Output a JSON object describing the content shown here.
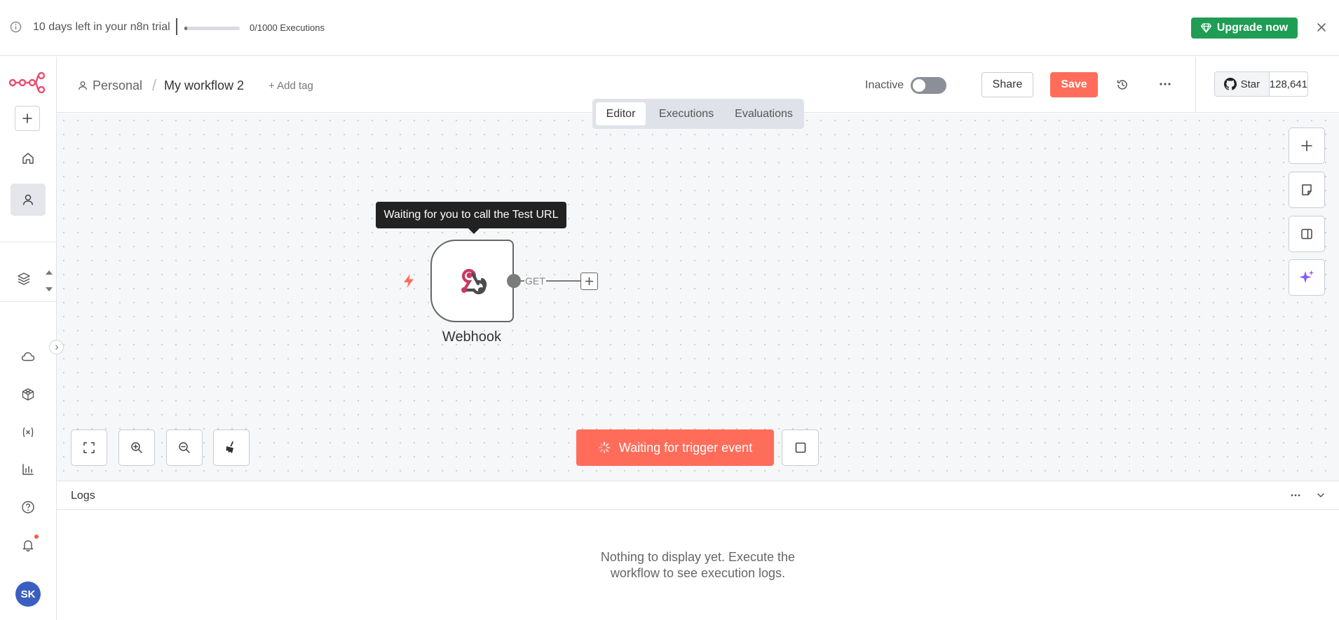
{
  "banner": {
    "trial_text": "10 days left in your n8n trial",
    "executions": "0/1000 Executions",
    "execution_progress": 0.02,
    "upgrade_label": "Upgrade now"
  },
  "breadcrumb": {
    "project": "Personal",
    "separator": "/",
    "workflow_name": "My workflow 2",
    "add_tag": "+ Add tag"
  },
  "header": {
    "status_label": "Inactive",
    "active": false,
    "share_label": "Share",
    "save_label": "Save",
    "github_star_label": "Star",
    "github_star_count": "128,641"
  },
  "tabs": [
    {
      "label": "Editor",
      "active": true
    },
    {
      "label": "Executions",
      "active": false
    },
    {
      "label": "Evaluations",
      "active": false
    }
  ],
  "canvas": {
    "tooltip": "Waiting for you to call the Test URL",
    "node_label": "Webhook",
    "output_label": "GET",
    "trigger_button": "Waiting for trigger event"
  },
  "sidebar": {
    "avatar_initials": "SK",
    "icons": [
      "home-icon",
      "user-icon",
      "layers-icon",
      "cloud-icon",
      "templates-icon",
      "variables-icon",
      "insights-icon",
      "help-icon",
      "bell-icon"
    ]
  },
  "logs": {
    "title": "Logs",
    "empty_line1": "Nothing to display yet. Execute the",
    "empty_line2": "workflow to see execution logs."
  },
  "colors": {
    "accent": "#ff6d5a",
    "upgrade": "#1f9d55",
    "avatar": "#3b5fc0",
    "ai": "#8b5cf6"
  }
}
